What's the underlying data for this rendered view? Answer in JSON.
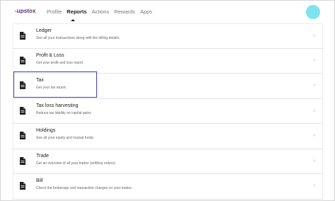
{
  "header": {
    "logo_text": "upstox",
    "nav": [
      "Profile",
      "Reports",
      "Actions",
      "Rewards",
      "Apps"
    ],
    "active_nav": "Reports",
    "avatar_color": "#7ee3f0",
    "brand_color": "#5a2a82"
  },
  "reports": [
    {
      "title": "Ledger",
      "desc": "See all your transactions along with the billing details.",
      "icon": "document-icon"
    },
    {
      "title": "Profit & Loss",
      "desc": "Get your profit and loss report",
      "icon": "document-icon"
    },
    {
      "title": "Tax",
      "desc": "Get your tax report.",
      "icon": "document-icon"
    },
    {
      "title": "Tax loss harvesting",
      "desc": "Reduce tax liability on capital gains",
      "icon": "document-icon"
    },
    {
      "title": "Holdings",
      "desc": "See all your equity and mutual funds.",
      "icon": "document-icon"
    },
    {
      "title": "Trade",
      "desc": "Get an overview of all your trades (sell/buy orders).",
      "icon": "document-icon"
    },
    {
      "title": "Bill",
      "desc": "Check the brokerage and transaction charges on your trades.",
      "icon": "document-icon"
    }
  ],
  "chevron_glyph": "›",
  "selection_color": "#3b3fa8"
}
